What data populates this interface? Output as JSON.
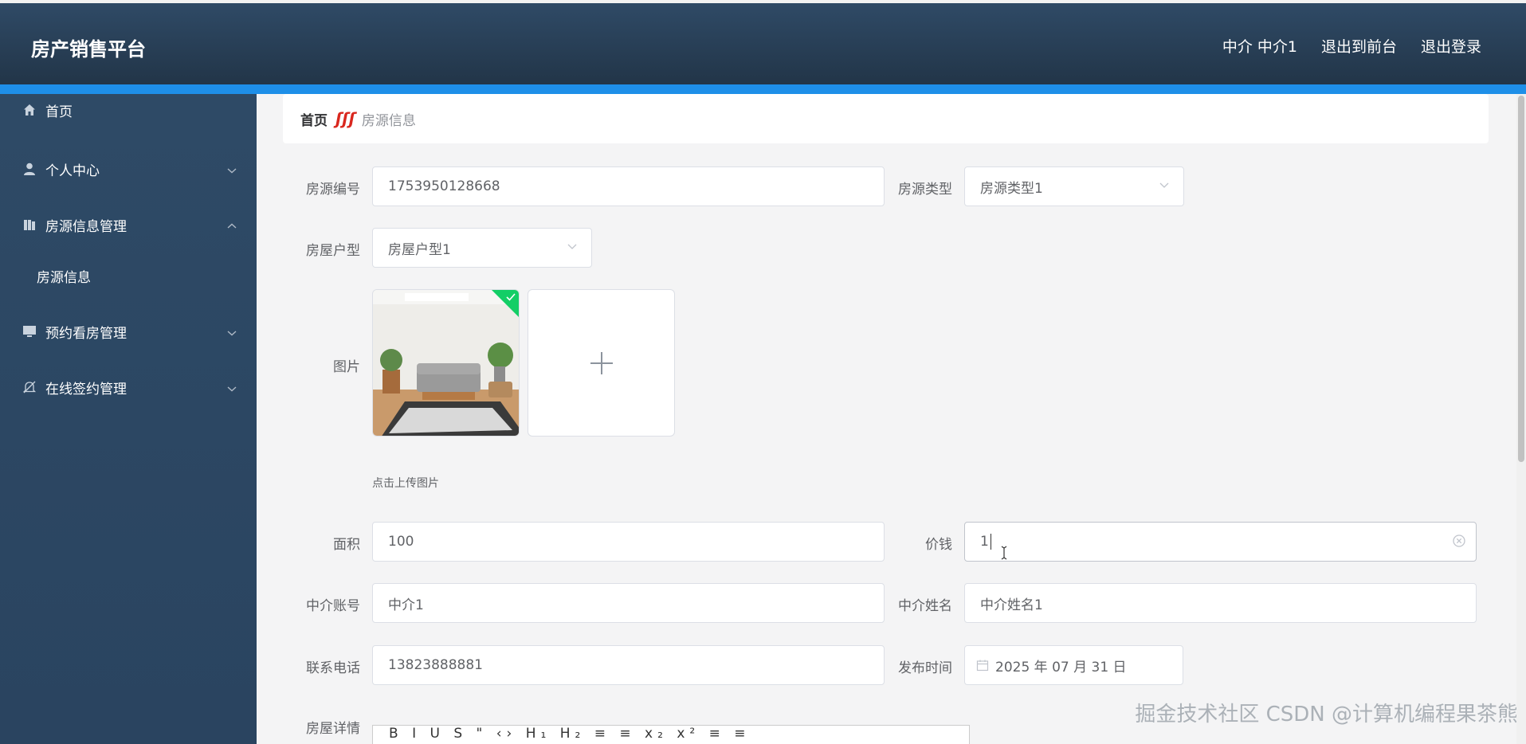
{
  "header": {
    "title": "房产销售平台",
    "user": "中介 中介1",
    "to_front": "退出到前台",
    "logout": "退出登录"
  },
  "sidebar": {
    "items": [
      {
        "label": "首页",
        "icon": "home-icon"
      },
      {
        "label": "个人中心",
        "icon": "user-icon"
      },
      {
        "label": "房源信息管理",
        "icon": "building-icon",
        "expanded": true
      },
      {
        "label": "房源信息",
        "sub": true
      },
      {
        "label": "预约看房管理",
        "icon": "monitor-icon"
      },
      {
        "label": "在线签约管理",
        "icon": "bell-off-icon"
      }
    ]
  },
  "breadcrumb": {
    "home": "首页",
    "separator": "ʃʃʃ",
    "current": "房源信息"
  },
  "form": {
    "house_no": {
      "label": "房源编号",
      "value": "1753950128668"
    },
    "house_type": {
      "label": "房源类型",
      "value": "房源类型1"
    },
    "layout": {
      "label": "房屋户型",
      "value": "房屋户型1"
    },
    "image": {
      "label": "图片",
      "hint": "点击上传图片"
    },
    "area": {
      "label": "面积",
      "value": "100"
    },
    "price": {
      "label": "价钱",
      "value": "1"
    },
    "agent_account": {
      "label": "中介账号",
      "value": "中介1"
    },
    "agent_name": {
      "label": "中介姓名",
      "value": "中介姓名1"
    },
    "phone": {
      "label": "联系电话",
      "value": "13823888881"
    },
    "publish_time": {
      "label": "发布时间",
      "value": "2025 年 07 月 31 日"
    },
    "details": {
      "label": "房屋详情",
      "toolbar": "B I U S \" ‹› H₁ H₂ ≡ ≡ x₂ x² ≡ ≡"
    }
  },
  "watermark": "CSDN @计算机编程果茶熊",
  "watermark2": "掘金技术社区",
  "colors": {
    "header_bg": "#263b52",
    "sidebar_bg": "#2d4863",
    "accent": "#1e8fe8",
    "success": "#13ce66"
  }
}
